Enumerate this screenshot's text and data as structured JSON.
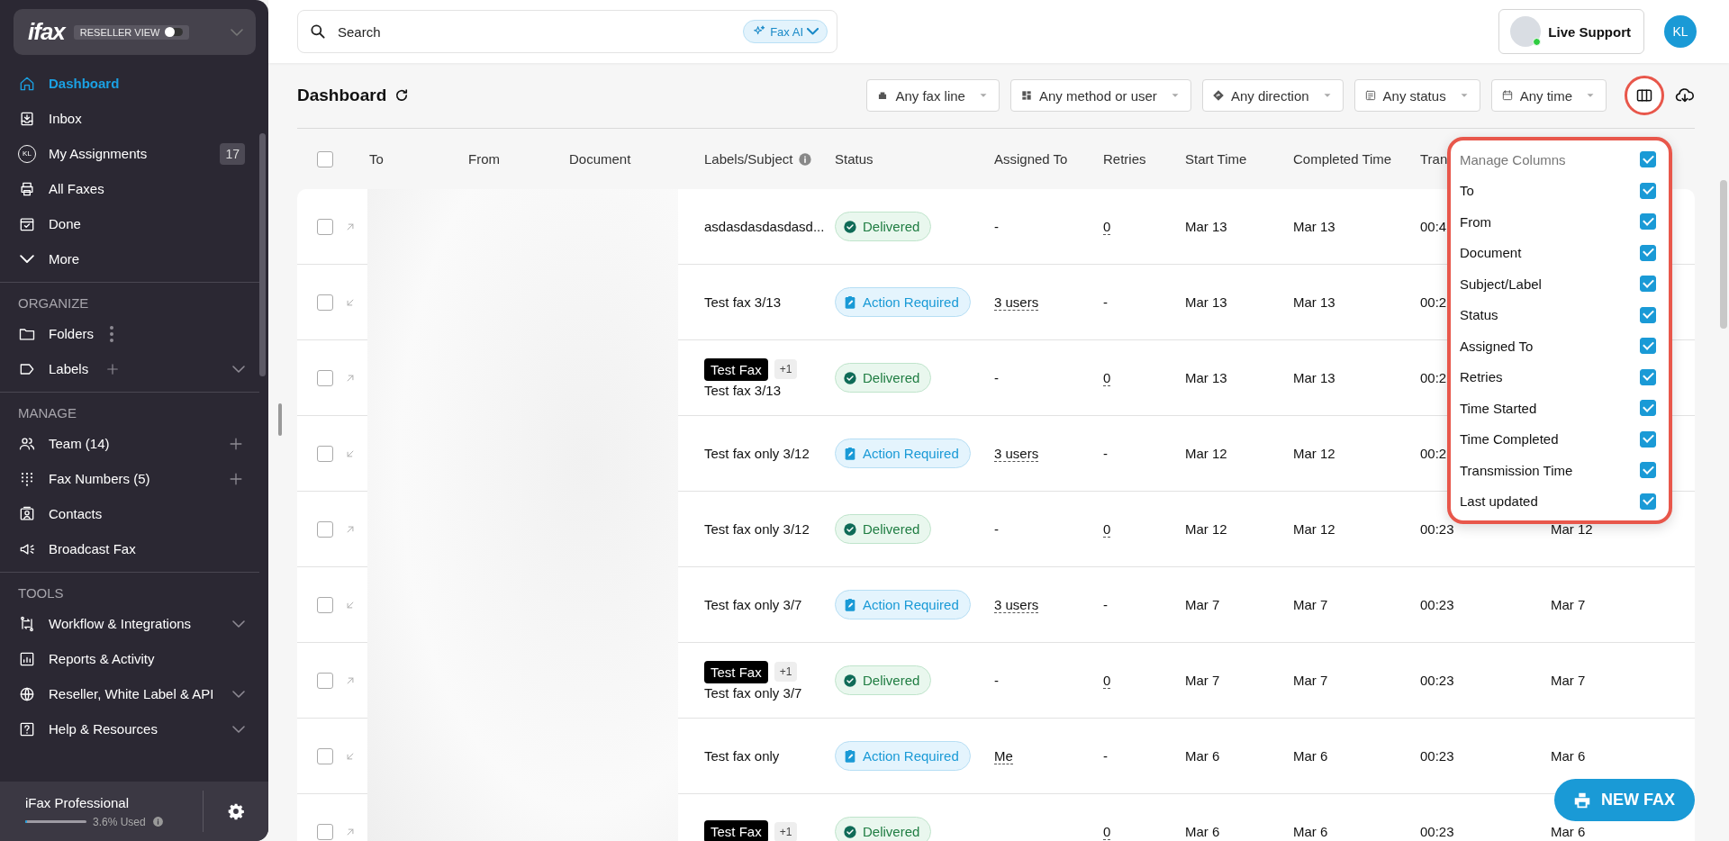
{
  "sidebar": {
    "brand": {
      "logo": "ifax",
      "toggle_label": "RESELLER VIEW",
      "on": false
    },
    "sections": [
      {
        "items": [
          {
            "label": "Dashboard",
            "kind": "plain",
            "selected": true
          },
          {
            "label": "Inbox",
            "kind": "plain",
            "selected": false
          },
          {
            "label": "My Assignments",
            "kind": "badge",
            "badge": "17",
            "icon_text": "KL",
            "selected": false
          },
          {
            "label": "All Faxes",
            "kind": "plain",
            "selected": false
          },
          {
            "label": "Done",
            "kind": "plain",
            "selected": false
          },
          {
            "label": "More",
            "kind": "more",
            "selected": false
          }
        ]
      },
      {
        "heading": "ORGANIZE",
        "items": [
          {
            "label": "Folders",
            "kind": "dots",
            "selected": false
          },
          {
            "label": "Labels",
            "kind": "plus-expand",
            "selected": false
          }
        ]
      },
      {
        "heading": "MANAGE",
        "items": [
          {
            "label": "Team (14)",
            "kind": "plus",
            "selected": false
          },
          {
            "label": "Fax Numbers (5)",
            "kind": "plus",
            "selected": false
          },
          {
            "label": "Contacts",
            "kind": "plain",
            "selected": false
          },
          {
            "label": "Broadcast Fax",
            "kind": "plain",
            "selected": false
          }
        ]
      },
      {
        "heading": "TOOLS",
        "items": [
          {
            "label": "Workflow & Integrations",
            "kind": "expand",
            "selected": false
          },
          {
            "label": "Reports & Activity",
            "kind": "plain",
            "selected": false
          },
          {
            "label": "Reseller, White Label & API",
            "kind": "expand",
            "selected": false
          },
          {
            "label": "Help & Resources",
            "kind": "expand",
            "selected": false
          }
        ]
      }
    ],
    "footer": {
      "plan": "iFax Professional",
      "level": 0.036,
      "usage": "3.6% Used"
    }
  },
  "topbar": {
    "search": {
      "placeholder": "Search"
    },
    "ai_button": "Fax AI",
    "support_button": "Live Support",
    "avatar": "KL"
  },
  "page": {
    "title": "Dashboard",
    "filters": [
      {
        "label": "Any fax line"
      },
      {
        "label": "Any method or user"
      },
      {
        "label": "Any direction"
      },
      {
        "label": "Any status"
      },
      {
        "label": "Any time"
      }
    ]
  },
  "table": {
    "select_all": {
      "checked": false
    },
    "columns": [
      {
        "label": "To",
        "kind": "plain"
      },
      {
        "label": "From",
        "kind": "plain"
      },
      {
        "label": "Document",
        "kind": "plain"
      },
      {
        "label": "Labels/Subject",
        "kind": "info"
      },
      {
        "label": "Status",
        "kind": "plain"
      },
      {
        "label": "Assigned To",
        "kind": "plain"
      },
      {
        "label": "Retries",
        "kind": "plain"
      },
      {
        "label": "Start Time",
        "kind": "plain"
      },
      {
        "label": "Completed Time",
        "kind": "plain"
      },
      {
        "label": "Tran",
        "kind": "plain"
      }
    ],
    "rows": [
      {
        "selected": false,
        "kind": "outgoing",
        "subject": "asdasdasdasdasd...",
        "status": {
          "kind": "delivered",
          "text": "Delivered"
        },
        "assigned": {
          "text": "-",
          "dotted": false
        },
        "retries": {
          "text": "0",
          "dotted": true
        },
        "start": "Mar 13",
        "completed": "Mar 13",
        "transmission": "00:4"
      },
      {
        "selected": false,
        "kind": "incoming",
        "subject": "Test fax 3/13",
        "status": {
          "kind": "action",
          "text": "Action Required"
        },
        "assigned": {
          "text": "3 users",
          "dotted": true
        },
        "retries": {
          "text": "-",
          "dotted": false
        },
        "start": "Mar 13",
        "completed": "Mar 13",
        "transmission": "00:2"
      },
      {
        "selected": false,
        "kind": "outgoing",
        "labels": [
          {
            "text": "Test Fax",
            "kind": "label"
          },
          {
            "text": "+1",
            "kind": "more"
          }
        ],
        "subject": "Test fax 3/13",
        "status": {
          "kind": "delivered",
          "text": "Delivered"
        },
        "assigned": {
          "text": "-",
          "dotted": false
        },
        "retries": {
          "text": "0",
          "dotted": true
        },
        "start": "Mar 13",
        "completed": "Mar 13",
        "transmission": "00:2"
      },
      {
        "selected": false,
        "kind": "incoming",
        "subject": "Test fax only 3/12",
        "status": {
          "kind": "action",
          "text": "Action Required"
        },
        "assigned": {
          "text": "3 users",
          "dotted": true
        },
        "retries": {
          "text": "-",
          "dotted": false
        },
        "start": "Mar 12",
        "completed": "Mar 12",
        "transmission": "00:2"
      },
      {
        "selected": false,
        "kind": "outgoing",
        "subject": "Test fax only 3/12",
        "status": {
          "kind": "delivered",
          "text": "Delivered"
        },
        "assigned": {
          "text": "-",
          "dotted": false
        },
        "retries": {
          "text": "0",
          "dotted": true
        },
        "start": "Mar 12",
        "completed": "Mar 12",
        "transmission": "00:23",
        "last_updated": "Mar 12"
      },
      {
        "selected": false,
        "kind": "incoming",
        "subject": "Test fax only 3/7",
        "status": {
          "kind": "action",
          "text": "Action Required"
        },
        "assigned": {
          "text": "3 users",
          "dotted": true
        },
        "retries": {
          "text": "-",
          "dotted": false
        },
        "start": "Mar 7",
        "completed": "Mar 7",
        "transmission": "00:23",
        "last_updated": "Mar 7"
      },
      {
        "selected": false,
        "kind": "outgoing",
        "labels": [
          {
            "text": "Test Fax",
            "kind": "label"
          },
          {
            "text": "+1",
            "kind": "more"
          }
        ],
        "subject": "Test fax only 3/7",
        "status": {
          "kind": "delivered",
          "text": "Delivered"
        },
        "assigned": {
          "text": "-",
          "dotted": false
        },
        "retries": {
          "text": "0",
          "dotted": true
        },
        "start": "Mar 7",
        "completed": "Mar 7",
        "transmission": "00:23",
        "last_updated": "Mar 7"
      },
      {
        "selected": false,
        "kind": "incoming",
        "subject": "Test fax only",
        "status": {
          "kind": "action",
          "text": "Action Required"
        },
        "assigned": {
          "text": "Me",
          "dotted": true
        },
        "retries": {
          "text": "-",
          "dotted": false
        },
        "start": "Mar 6",
        "completed": "Mar 6",
        "transmission": "00:23",
        "last_updated": "Mar 6"
      },
      {
        "selected": false,
        "kind": "outgoing",
        "labels": [
          {
            "text": "Test Fax",
            "kind": "label"
          },
          {
            "text": "+1",
            "kind": "more"
          }
        ],
        "status": {
          "kind": "delivered",
          "text": "Delivered"
        },
        "retries": {
          "text": "0",
          "dotted": true
        },
        "start": "Mar 6",
        "completed": "Mar 6",
        "transmission": "00:23",
        "last_updated": "Mar 6"
      }
    ]
  },
  "column_menu": {
    "title": "Manage Columns",
    "checked": true,
    "items": [
      {
        "label": "To",
        "checked": true
      },
      {
        "label": "From",
        "checked": true
      },
      {
        "label": "Document",
        "checked": true
      },
      {
        "label": "Subject/Label",
        "checked": true
      },
      {
        "label": "Status",
        "checked": true
      },
      {
        "label": "Assigned To",
        "checked": true
      },
      {
        "label": "Retries",
        "checked": true
      },
      {
        "label": "Time Started",
        "checked": true
      },
      {
        "label": "Time Completed",
        "checked": true
      },
      {
        "label": "Transmission Time",
        "checked": true
      },
      {
        "label": "Last updated",
        "checked": true
      }
    ]
  },
  "new_fax_button": "NEW FAX"
}
